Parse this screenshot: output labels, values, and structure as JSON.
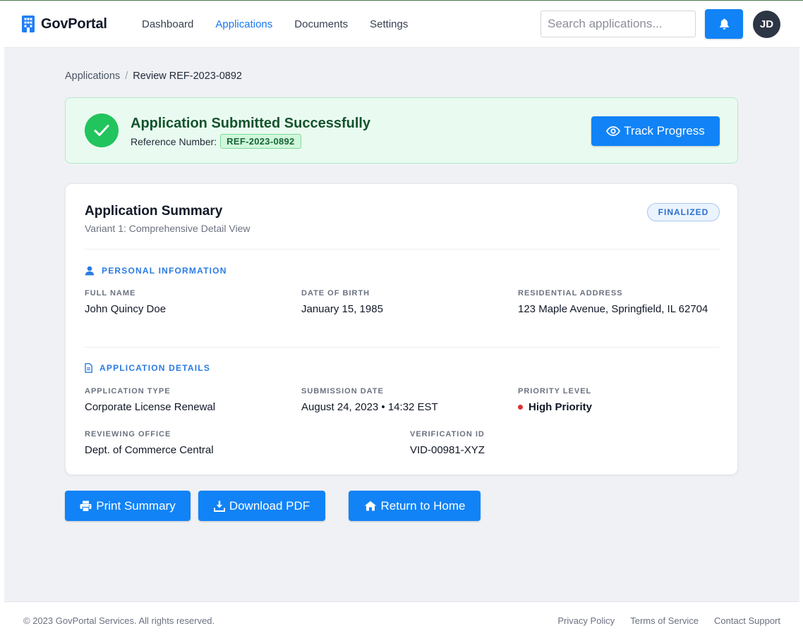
{
  "app": {
    "name": "GovPortal",
    "logo_icon": "building-icon"
  },
  "nav": {
    "items": [
      {
        "label": "Dashboard",
        "active": false
      },
      {
        "label": "Applications",
        "active": true
      },
      {
        "label": "Documents",
        "active": false
      },
      {
        "label": "Settings",
        "active": false
      }
    ]
  },
  "search": {
    "placeholder": "Search applications...",
    "value": ""
  },
  "user": {
    "initials": "JD"
  },
  "breadcrumb": {
    "parent": "Applications",
    "separator": "/",
    "current": "Review REF-2023-0892"
  },
  "banner": {
    "title": "Application Submitted Successfully",
    "ref_label": "Reference Number:",
    "ref_number": "REF-2023-0892",
    "track_button": "Track Progress"
  },
  "summary": {
    "title": "Application Summary",
    "subtitle": "Variant 1: Comprehensive Detail View",
    "status": "FINALIZED",
    "personal": {
      "heading": "PERSONAL INFORMATION",
      "full_name_label": "FULL NAME",
      "full_name": "John Quincy Doe",
      "dob_label": "DATE OF BIRTH",
      "dob": "January 15, 1985",
      "address_label": "RESIDENTIAL ADDRESS",
      "address": "123 Maple Avenue, Springfield, IL 62704"
    },
    "details": {
      "heading": "APPLICATION DETAILS",
      "type_label": "APPLICATION TYPE",
      "type": "Corporate License Renewal",
      "submission_label": "SUBMISSION DATE",
      "submission": "August 24, 2023 • 14:32 EST",
      "priority_label": "PRIORITY LEVEL",
      "priority": "High Priority",
      "office_label": "REVIEWING OFFICE",
      "office": "Dept. of Commerce Central",
      "verification_label": "VERIFICATION ID",
      "verification": "VID-00981-XYZ"
    }
  },
  "actions": {
    "print": "Print Summary",
    "download": "Download PDF",
    "home": "Return to Home"
  },
  "footer": {
    "copyright": "© 2023 GovPortal Services. All rights reserved.",
    "links": [
      "Privacy Policy",
      "Terms of Service",
      "Contact Support"
    ]
  },
  "colors": {
    "primary": "#1183f6",
    "success": "#21c45d",
    "danger": "#e03131"
  }
}
